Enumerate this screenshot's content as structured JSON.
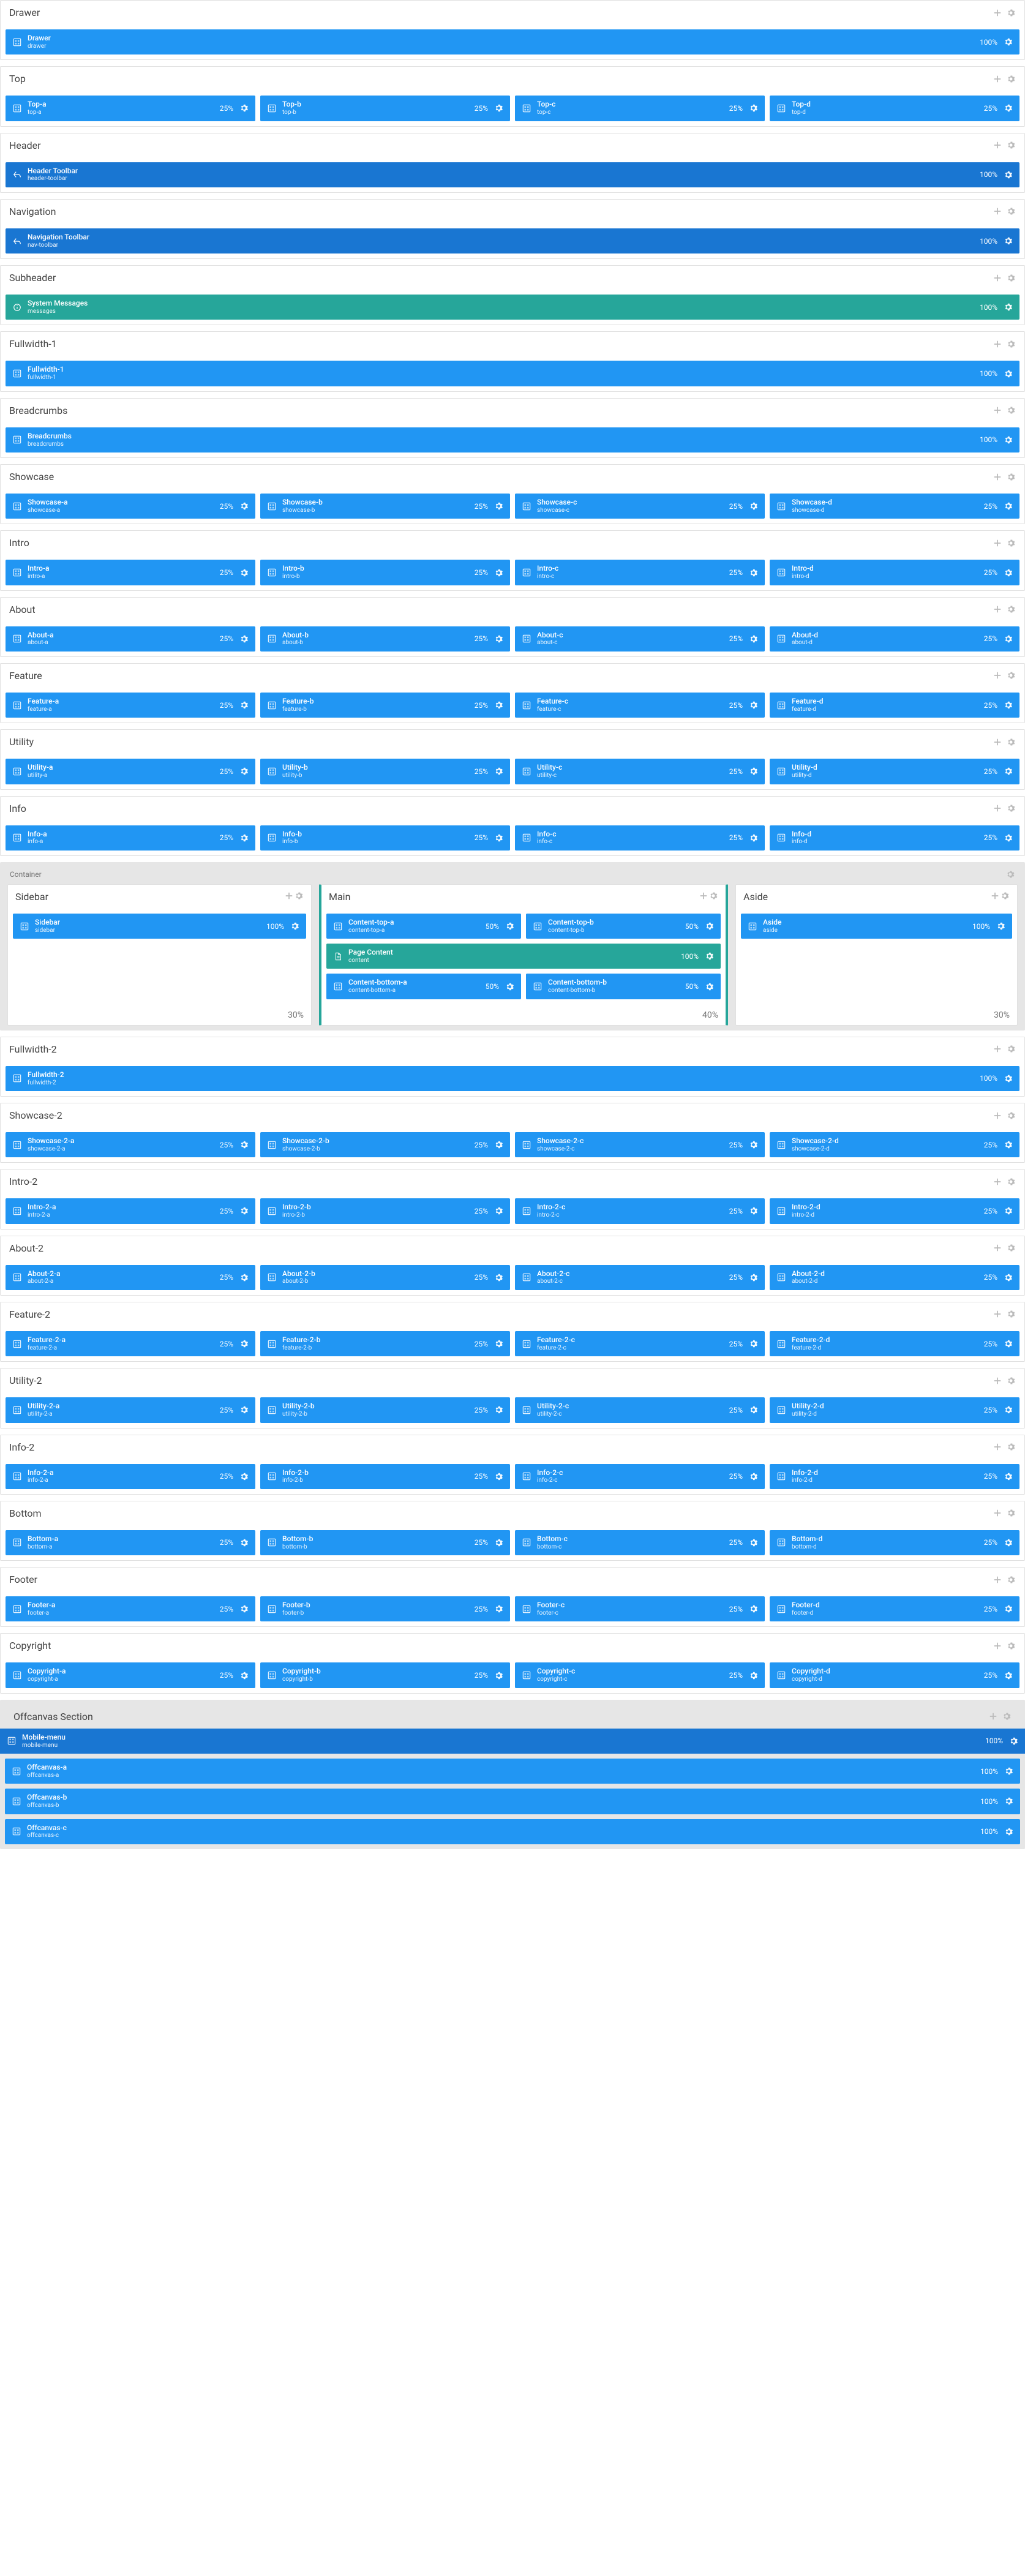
{
  "sections": [
    {
      "id": "drawer",
      "title": "Drawer",
      "type": "single",
      "style": "blue",
      "blocks": [
        {
          "title": "Drawer",
          "sub": "drawer",
          "pct": "100%"
        }
      ]
    },
    {
      "id": "top",
      "title": "Top",
      "type": "row4",
      "style": "blue",
      "blocks": [
        {
          "title": "Top-a",
          "sub": "top-a",
          "pct": "25%"
        },
        {
          "title": "Top-b",
          "sub": "top-b",
          "pct": "25%"
        },
        {
          "title": "Top-c",
          "sub": "top-c",
          "pct": "25%"
        },
        {
          "title": "Top-d",
          "sub": "top-d",
          "pct": "25%"
        }
      ]
    },
    {
      "id": "header",
      "title": "Header",
      "type": "single",
      "style": "dkblue",
      "icon": "back",
      "blocks": [
        {
          "title": "Header Toolbar",
          "sub": "header-toolbar",
          "pct": "100%"
        }
      ]
    },
    {
      "id": "navigation",
      "title": "Navigation",
      "type": "single",
      "style": "dkblue",
      "icon": "back",
      "blocks": [
        {
          "title": "Navigation Toolbar",
          "sub": "nav-toolbar",
          "pct": "100%"
        }
      ]
    },
    {
      "id": "subheader",
      "title": "Subheader",
      "type": "single",
      "style": "green",
      "icon": "info",
      "blocks": [
        {
          "title": "System Messages",
          "sub": "messages",
          "pct": "100%"
        }
      ]
    },
    {
      "id": "fullwidth-1",
      "title": "Fullwidth-1",
      "type": "single",
      "style": "blue",
      "blocks": [
        {
          "title": "Fullwidth-1",
          "sub": "fullwidth-1",
          "pct": "100%"
        }
      ]
    },
    {
      "id": "breadcrumbs",
      "title": "Breadcrumbs",
      "type": "single",
      "style": "blue",
      "blocks": [
        {
          "title": "Breadcrumbs",
          "sub": "breadcrumbs",
          "pct": "100%"
        }
      ]
    },
    {
      "id": "showcase",
      "title": "Showcase",
      "type": "row4",
      "style": "blue",
      "blocks": [
        {
          "title": "Showcase-a",
          "sub": "showcase-a",
          "pct": "25%"
        },
        {
          "title": "Showcase-b",
          "sub": "showcase-b",
          "pct": "25%"
        },
        {
          "title": "Showcase-c",
          "sub": "showcase-c",
          "pct": "25%"
        },
        {
          "title": "Showcase-d",
          "sub": "showcase-d",
          "pct": "25%"
        }
      ]
    },
    {
      "id": "intro",
      "title": "Intro",
      "type": "row4",
      "style": "blue",
      "blocks": [
        {
          "title": "Intro-a",
          "sub": "intro-a",
          "pct": "25%"
        },
        {
          "title": "Intro-b",
          "sub": "intro-b",
          "pct": "25%"
        },
        {
          "title": "Intro-c",
          "sub": "intro-c",
          "pct": "25%"
        },
        {
          "title": "Intro-d",
          "sub": "intro-d",
          "pct": "25%"
        }
      ]
    },
    {
      "id": "about",
      "title": "About",
      "type": "row4",
      "style": "blue",
      "blocks": [
        {
          "title": "About-a",
          "sub": "about-a",
          "pct": "25%"
        },
        {
          "title": "About-b",
          "sub": "about-b",
          "pct": "25%"
        },
        {
          "title": "About-c",
          "sub": "about-c",
          "pct": "25%"
        },
        {
          "title": "About-d",
          "sub": "about-d",
          "pct": "25%"
        }
      ]
    },
    {
      "id": "feature",
      "title": "Feature",
      "type": "row4",
      "style": "blue",
      "blocks": [
        {
          "title": "Feature-a",
          "sub": "feature-a",
          "pct": "25%"
        },
        {
          "title": "Feature-b",
          "sub": "feature-b",
          "pct": "25%"
        },
        {
          "title": "Feature-c",
          "sub": "feature-c",
          "pct": "25%"
        },
        {
          "title": "Feature-d",
          "sub": "feature-d",
          "pct": "25%"
        }
      ]
    },
    {
      "id": "utility",
      "title": "Utility",
      "type": "row4",
      "style": "blue",
      "blocks": [
        {
          "title": "Utility-a",
          "sub": "utility-a",
          "pct": "25%"
        },
        {
          "title": "Utility-b",
          "sub": "utility-b",
          "pct": "25%"
        },
        {
          "title": "Utility-c",
          "sub": "utility-c",
          "pct": "25%"
        },
        {
          "title": "Utility-d",
          "sub": "utility-d",
          "pct": "25%"
        }
      ]
    },
    {
      "id": "info",
      "title": "Info",
      "type": "row4",
      "style": "blue",
      "blocks": [
        {
          "title": "Info-a",
          "sub": "info-a",
          "pct": "25%"
        },
        {
          "title": "Info-b",
          "sub": "info-b",
          "pct": "25%"
        },
        {
          "title": "Info-c",
          "sub": "info-c",
          "pct": "25%"
        },
        {
          "title": "Info-d",
          "sub": "info-d",
          "pct": "25%"
        }
      ]
    }
  ],
  "container": {
    "label": "Container",
    "sidebar": {
      "title": "Sidebar",
      "blocks": [
        {
          "title": "Sidebar",
          "sub": "sidebar",
          "pct": "100%"
        }
      ],
      "footer": "30%"
    },
    "main": {
      "title": "Main",
      "rows": [
        [
          {
            "title": "Content-top-a",
            "sub": "content-top-a",
            "pct": "50%",
            "style": "blue"
          },
          {
            "title": "Content-top-b",
            "sub": "content-top-b",
            "pct": "50%",
            "style": "blue"
          }
        ],
        [
          {
            "title": "Page Content",
            "sub": "content",
            "pct": "100%",
            "style": "green",
            "icon": "page"
          }
        ],
        [
          {
            "title": "Content-bottom-a",
            "sub": "content-bottom-a",
            "pct": "50%",
            "style": "blue"
          },
          {
            "title": "Content-bottom-b",
            "sub": "content-bottom-b",
            "pct": "50%",
            "style": "blue"
          }
        ]
      ],
      "footer": "40%"
    },
    "aside": {
      "title": "Aside",
      "blocks": [
        {
          "title": "Aside",
          "sub": "aside",
          "pct": "100%"
        }
      ],
      "footer": "30%"
    }
  },
  "sections2": [
    {
      "id": "fullwidth-2",
      "title": "Fullwidth-2",
      "type": "single",
      "style": "blue",
      "blocks": [
        {
          "title": "Fullwidth-2",
          "sub": "fullwidth-2",
          "pct": "100%"
        }
      ]
    },
    {
      "id": "showcase-2",
      "title": "Showcase-2",
      "type": "row4",
      "style": "blue",
      "blocks": [
        {
          "title": "Showcase-2-a",
          "sub": "showcase-2-a",
          "pct": "25%"
        },
        {
          "title": "Showcase-2-b",
          "sub": "showcase-2-b",
          "pct": "25%"
        },
        {
          "title": "Showcase-2-c",
          "sub": "showcase-2-c",
          "pct": "25%"
        },
        {
          "title": "Showcase-2-d",
          "sub": "showcase-2-d",
          "pct": "25%"
        }
      ]
    },
    {
      "id": "intro-2",
      "title": "Intro-2",
      "type": "row4",
      "style": "blue",
      "blocks": [
        {
          "title": "Intro-2-a",
          "sub": "intro-2-a",
          "pct": "25%"
        },
        {
          "title": "Intro-2-b",
          "sub": "intro-2-b",
          "pct": "25%"
        },
        {
          "title": "Intro-2-c",
          "sub": "intro-2-c",
          "pct": "25%"
        },
        {
          "title": "Intro-2-d",
          "sub": "intro-2-d",
          "pct": "25%"
        }
      ]
    },
    {
      "id": "about-2",
      "title": "About-2",
      "type": "row4",
      "style": "blue",
      "blocks": [
        {
          "title": "About-2-a",
          "sub": "about-2-a",
          "pct": "25%"
        },
        {
          "title": "About-2-b",
          "sub": "about-2-b",
          "pct": "25%"
        },
        {
          "title": "About-2-c",
          "sub": "about-2-c",
          "pct": "25%"
        },
        {
          "title": "About-2-d",
          "sub": "about-2-d",
          "pct": "25%"
        }
      ]
    },
    {
      "id": "feature-2",
      "title": "Feature-2",
      "type": "row4",
      "style": "blue",
      "blocks": [
        {
          "title": "Feature-2-a",
          "sub": "feature-2-a",
          "pct": "25%"
        },
        {
          "title": "Feature-2-b",
          "sub": "feature-2-b",
          "pct": "25%"
        },
        {
          "title": "Feature-2-c",
          "sub": "feature-2-c",
          "pct": "25%"
        },
        {
          "title": "Feature-2-d",
          "sub": "feature-2-d",
          "pct": "25%"
        }
      ]
    },
    {
      "id": "utility-2",
      "title": "Utility-2",
      "type": "row4",
      "style": "blue",
      "blocks": [
        {
          "title": "Utility-2-a",
          "sub": "utility-2-a",
          "pct": "25%"
        },
        {
          "title": "Utility-2-b",
          "sub": "utility-2-b",
          "pct": "25%"
        },
        {
          "title": "Utility-2-c",
          "sub": "utility-2-c",
          "pct": "25%"
        },
        {
          "title": "Utility-2-d",
          "sub": "utility-2-d",
          "pct": "25%"
        }
      ]
    },
    {
      "id": "info-2",
      "title": "Info-2",
      "type": "row4",
      "style": "blue",
      "blocks": [
        {
          "title": "Info-2-a",
          "sub": "info-2-a",
          "pct": "25%"
        },
        {
          "title": "Info-2-b",
          "sub": "info-2-b",
          "pct": "25%"
        },
        {
          "title": "Info-2-c",
          "sub": "info-2-c",
          "pct": "25%"
        },
        {
          "title": "Info-2-d",
          "sub": "info-2-d",
          "pct": "25%"
        }
      ]
    },
    {
      "id": "bottom",
      "title": "Bottom",
      "type": "row4",
      "style": "blue",
      "blocks": [
        {
          "title": "Bottom-a",
          "sub": "bottom-a",
          "pct": "25%"
        },
        {
          "title": "Bottom-b",
          "sub": "bottom-b",
          "pct": "25%"
        },
        {
          "title": "Bottom-c",
          "sub": "bottom-c",
          "pct": "25%"
        },
        {
          "title": "Bottom-d",
          "sub": "bottom-d",
          "pct": "25%"
        }
      ]
    },
    {
      "id": "footer",
      "title": "Footer",
      "type": "row4",
      "style": "blue",
      "blocks": [
        {
          "title": "Footer-a",
          "sub": "footer-a",
          "pct": "25%"
        },
        {
          "title": "Footer-b",
          "sub": "footer-b",
          "pct": "25%"
        },
        {
          "title": "Footer-c",
          "sub": "footer-c",
          "pct": "25%"
        },
        {
          "title": "Footer-d",
          "sub": "footer-d",
          "pct": "25%"
        }
      ]
    },
    {
      "id": "copyright",
      "title": "Copyright",
      "type": "row4",
      "style": "blue",
      "blocks": [
        {
          "title": "Copyright-a",
          "sub": "copyright-a",
          "pct": "25%"
        },
        {
          "title": "Copyright-b",
          "sub": "copyright-b",
          "pct": "25%"
        },
        {
          "title": "Copyright-c",
          "sub": "copyright-c",
          "pct": "25%"
        },
        {
          "title": "Copyright-d",
          "sub": "copyright-d",
          "pct": "25%"
        }
      ]
    }
  ],
  "offcanvas": {
    "title": "Offcanvas Section",
    "blocks": [
      {
        "title": "Mobile-menu",
        "sub": "mobile-menu",
        "pct": "100%",
        "style": "dkblue",
        "fullbleed": true
      },
      {
        "title": "Offcanvas-a",
        "sub": "offcanvas-a",
        "pct": "100%",
        "style": "blue"
      },
      {
        "title": "Offcanvas-b",
        "sub": "offcanvas-b",
        "pct": "100%",
        "style": "blue"
      },
      {
        "title": "Offcanvas-c",
        "sub": "offcanvas-c",
        "pct": "100%",
        "style": "blue"
      }
    ]
  }
}
